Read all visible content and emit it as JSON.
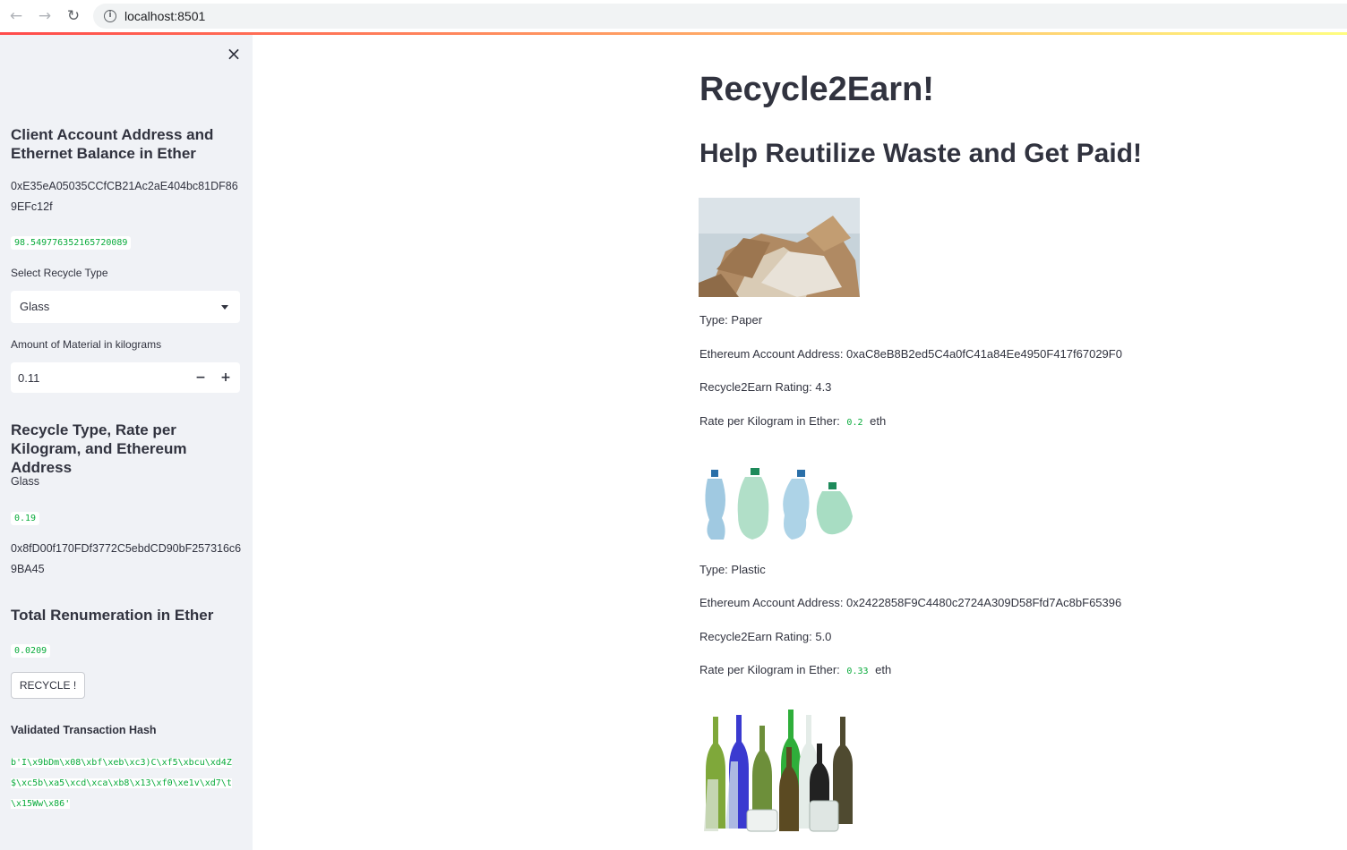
{
  "browser": {
    "url": "localhost:8501",
    "back_icon": "arrow-left-icon",
    "forward_icon": "arrow-right-icon",
    "reload_icon": "reload-icon",
    "info_icon": "info-icon"
  },
  "colors": {
    "sidebar_bg": "#f0f2f6",
    "code_green": "#09ab3b",
    "decoration_start": "#ff4b4b",
    "decoration_end": "#fffd80",
    "text": "#31333f"
  },
  "sidebar": {
    "close_label": "×",
    "account_header": "Client Account Address and Ethernet Balance in Ether",
    "account_address": "0xE35eA05035CCfCB21Ac2aE404bc81DF869EFc12f",
    "balance": "98.549776352165720089",
    "select_label": "Select Recycle Type",
    "select_value": "Glass",
    "amount_label": "Amount of Material in kilograms",
    "amount_value": "0.11",
    "minus_label": "−",
    "plus_label": "+",
    "rate_header": "Recycle Type, Rate per Kilogram, and Ethereum Address",
    "selected_type": "Glass",
    "selected_rate": "0.19",
    "selected_address": "0x8fD00f170FDf3772C5ebdCD90bF257316c69BA45",
    "total_header": "Total Renumeration in Ether",
    "total_value": "0.0209",
    "recycle_button": "RECYCLE !",
    "hash_header": "Validated Transaction Hash",
    "hash_value": "b'I\\x9bDm\\x08\\xbf\\xeb\\xc3)C\\xf5\\xbcu\\xd4Z$\\xc5b\\xa5\\xcd\\xca\\xb8\\x13\\xf0\\xe1v\\xd7\\t\\x15Ww\\x86'"
  },
  "main": {
    "title": "Recycle2Earn!",
    "subtitle": "Help Reutilize Waste and Get Paid!",
    "items": [
      {
        "type": "Type: Paper",
        "address": "Ethereum Account Address: 0xaC8eB8B2ed5C4a0fC41a84Ee4950F417f67029F0",
        "rating": "Recycle2Earn Rating: 4.3",
        "rate_prefix": "Rate per Kilogram in Ether:",
        "rate_value": "0.2",
        "rate_unit": "eth"
      },
      {
        "type": "Type: Plastic",
        "address": "Ethereum Account Address: 0x2422858F9C4480c2724A309D58Ffd7Ac8bF65396",
        "rating": "Recycle2Earn Rating: 5.0",
        "rate_prefix": "Rate per Kilogram in Ether:",
        "rate_value": "0.33",
        "rate_unit": "eth"
      }
    ]
  }
}
